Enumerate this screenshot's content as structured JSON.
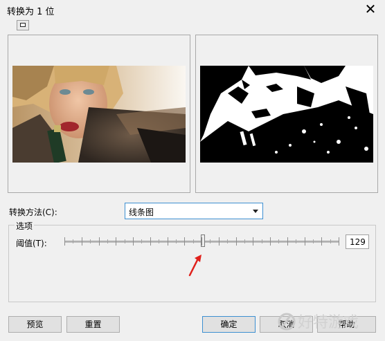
{
  "window": {
    "title": "转换为 1 位",
    "close_glyph": "✕"
  },
  "toolbar": {
    "view_toggle_icon": "split-view-icon"
  },
  "method": {
    "label": "转换方法(C):",
    "selected": "线条图"
  },
  "options": {
    "group_title": "选项",
    "threshold_label": "阈值(T):",
    "threshold_value": "129",
    "slider": {
      "min": 0,
      "max": 255,
      "value": 129
    }
  },
  "buttons": {
    "preview": "预览",
    "reset": "重置",
    "ok": "确定",
    "cancel": "取消",
    "help": "帮助"
  },
  "watermark": {
    "text": "好特游戏"
  },
  "colors": {
    "accent": "#3c8fd1",
    "arrow": "#e0201b"
  }
}
